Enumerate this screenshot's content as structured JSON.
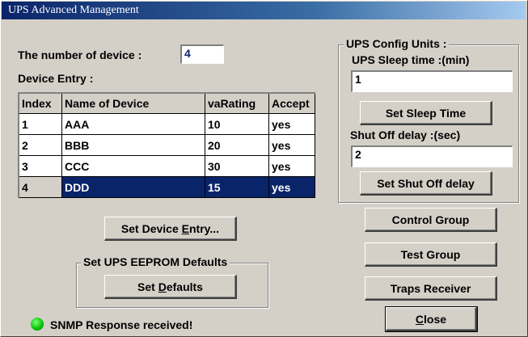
{
  "window": {
    "title": "UPS Advanced Management"
  },
  "device_count": {
    "label": "The number of device  :",
    "value": "4"
  },
  "device_entry": {
    "label": "Device Entry :",
    "columns": [
      "Index",
      "Name of Device",
      "vaRating",
      "Accept"
    ],
    "rows": [
      {
        "index": "1",
        "name": "AAA",
        "va": "10",
        "accept": "yes"
      },
      {
        "index": "2",
        "name": "BBB",
        "va": "20",
        "accept": "yes"
      },
      {
        "index": "3",
        "name": "CCC",
        "va": "30",
        "accept": "yes"
      },
      {
        "index": "4",
        "name": "DDD",
        "va": "15",
        "accept": "yes"
      }
    ],
    "selected_row": "4",
    "set_button": {
      "prefix": "Set Device ",
      "mnemonic": "E",
      "suffix": "ntry..."
    }
  },
  "eeprom": {
    "legend": "Set UPS EEPROM Defaults",
    "button": {
      "prefix": "Set ",
      "mnemonic": "D",
      "suffix": "efaults"
    }
  },
  "config": {
    "legend": "UPS Config Units :",
    "sleep_label": "UPS Sleep time :(min)",
    "sleep_value": "1",
    "sleep_button": "Set Sleep Time",
    "shutoff_label": "Shut Off delay :(sec)",
    "shutoff_value": "2",
    "shutoff_button": "Set Shut Off delay"
  },
  "side_buttons": {
    "control": "Control Group",
    "test": "Test Group",
    "traps": "Traps Receiver",
    "close": {
      "mnemonic": "C",
      "suffix": "lose"
    }
  },
  "status": {
    "text": "SNMP Response received!",
    "color": "#00c000"
  },
  "colors": {
    "title_bar": "#0a246a",
    "selection": "#0a246a",
    "face": "#d4d0c8"
  }
}
